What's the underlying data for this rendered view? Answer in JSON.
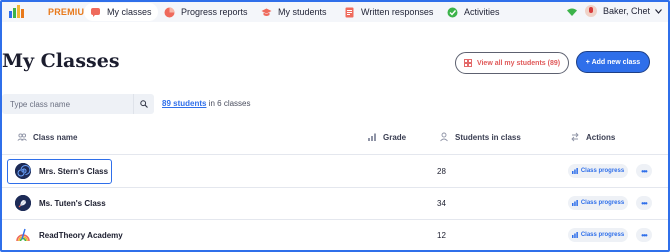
{
  "nav": {
    "premium_label": "PREMIUM",
    "items": [
      {
        "label": "My classes",
        "icon": "chat-icon"
      },
      {
        "label": "Progress reports",
        "icon": "chart-icon"
      },
      {
        "label": "My students",
        "icon": "students-icon"
      },
      {
        "label": "Written responses",
        "icon": "document-icon"
      },
      {
        "label": "Activities",
        "icon": "check-icon"
      }
    ],
    "user_name": "Baker, Chet"
  },
  "page": {
    "title": "My Classes",
    "view_all_label": "View all my students (89)",
    "add_class_label": "+ Add new class"
  },
  "search": {
    "placeholder": "Type class name"
  },
  "summary": {
    "students_link": "89 students",
    "suffix": "in 6 classes"
  },
  "table": {
    "headers": {
      "name": "Class name",
      "grade": "Grade",
      "students": "Students in class",
      "actions": "Actions"
    },
    "rows": [
      {
        "name": "Mrs. Stern's Class",
        "grade": "",
        "students": "28",
        "progress_label": "Class progress",
        "more_label": "•••"
      },
      {
        "name": "Ms. Tuten's Class",
        "grade": "",
        "students": "34",
        "progress_label": "Class progress",
        "more_label": "•••"
      },
      {
        "name": "ReadTheory Academy",
        "grade": "",
        "students": "12",
        "progress_label": "Class progress",
        "more_label": "•••"
      }
    ]
  },
  "colors": {
    "accent": "#2f6fea",
    "premium": "#e8791b",
    "nav_bg": "#f4f6fa"
  }
}
